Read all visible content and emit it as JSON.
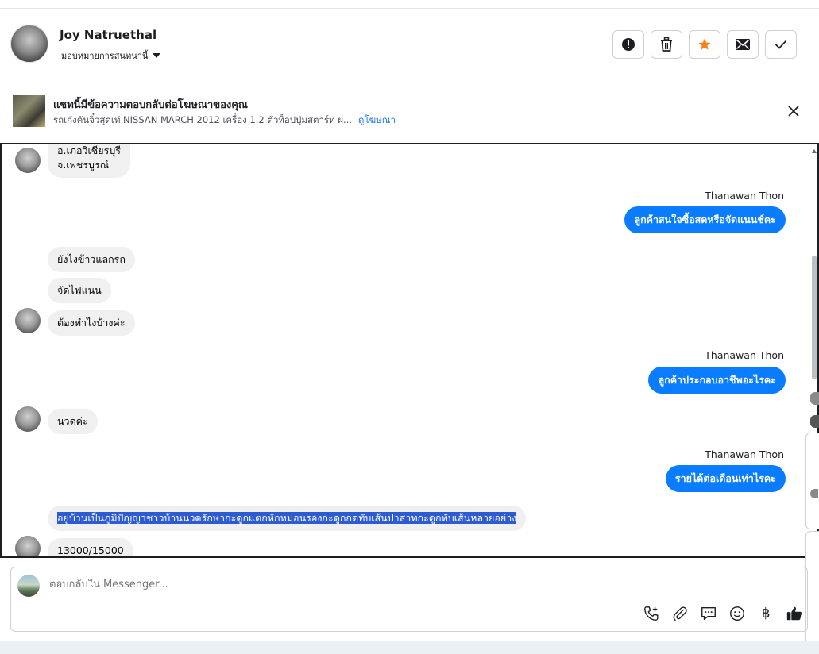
{
  "header": {
    "name": "Joy Natruethal",
    "assign_label": "มอบหมายการสนทนานี้"
  },
  "ad": {
    "title": "แชทนี้มีข้อความตอบกลับต่อโฆษณาของคุณ",
    "subtitle": "รถเก๋งคันจิ๋วสุดเท่ NISSAN MARCH 2012 เครื่อง 1.2 ตัวท็อปปุ่มสตาร์ท ผ่...",
    "link": "ดูโฆษณา"
  },
  "messages": {
    "m1_line1": "อ.เภอวิเชียรบุรี",
    "m1_line2": "จ.เพชรบูรณ์",
    "sender1": "Thanawan Thon",
    "out1": "ลูกค้าสนใจซื้อสดหรือจัดแนนช์คะ",
    "in2": "ยังไงข้าวแลกรถ",
    "in3": "จัดไฟแนน",
    "in4": "ต้องทำไงบ้างค่ะ",
    "sender2": "Thanawan Thon",
    "out2": "ลูกค้าประกอบอาชีพอะไรคะ",
    "in5": "นวดค่ะ",
    "sender3": "Thanawan Thon",
    "out3": "รายได้ต่อเดือนเท่าไรคะ",
    "in6": "อยู่บ้านเป็นภูมิปัญญาชาวบ้านนวดรักษากะดูกแตกหักหมอนรองกะดูกกดทับเส้นปาสาทกะดูกทับเส้นหลายอย่าง",
    "in7": "13000/15000"
  },
  "composer": {
    "placeholder": "ตอบกลับใน Messenger...",
    "baht_symbol": "฿"
  },
  "colors": {
    "accent": "#0a7cff",
    "star": "#f5821f",
    "link": "#1877f2"
  },
  "icons": [
    "alert-icon",
    "trash-icon",
    "star-icon",
    "envelope-icon",
    "check-icon",
    "close-icon",
    "phone-add-icon",
    "paperclip-icon",
    "chat-bubble-icon",
    "emoji-icon",
    "baht-icon",
    "thumbs-up-icon"
  ]
}
